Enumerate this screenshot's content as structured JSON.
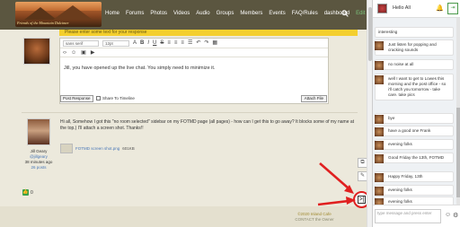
{
  "header": {
    "logo_text": "Friends of the Mountain Dulcimer",
    "nav": [
      "Home",
      "Forums",
      "Photos",
      "Videos",
      "Audio",
      "Groups",
      "Members",
      "Events",
      "FAQ/Rules",
      "dashboard",
      "Edit Look"
    ]
  },
  "yellow_bar": "Please enter some text for your response",
  "editor": {
    "font_select": "sans serif",
    "size_select": "12pt",
    "text": "Jill, you have opened up the live chat. You simply need to minimize it.",
    "post_button": "Post Response",
    "share_label": "Share To Timeline",
    "attach_button": "Attach File"
  },
  "comment": {
    "author": "Jill Geary",
    "handle": "@jillgeary",
    "time": "38 minutes ago",
    "points": "26 posts",
    "text": "Hi all, Somehow I got this \"no room selected\" sidebar on my FOTMD page (all pages) - how can I get this to go away? It blocks some of my name at the top.) I'll attach a screen shot. Thanks!!",
    "attachment_name": "FOTMD screen shot.png",
    "attachment_size": "601KB"
  },
  "likes": "0",
  "footer": {
    "line1": "©2020 Inland Cafe",
    "line2": "CONTACT the Owner"
  },
  "chat": {
    "greeting": "Hello All",
    "input_placeholder": "type message and press enter",
    "messages": [
      "interesting",
      "Just listen for popping and cracking sounds",
      "no noise at all",
      "well I want to get to Lowes this morning and the post office - so i'll catch you tomorrow - take care. take pics",
      "bye",
      "have a good one Frank",
      "evening folks",
      "Good Friday the 13th, FOTMD",
      "Happy Friday, 13th",
      "evening folks",
      "evening folks"
    ]
  },
  "colors": {
    "header_bg": "#5b5640",
    "yellow_bar": "#f4cf2e",
    "annotation_red": "#e02020",
    "chat_bg": "#eef1f4"
  }
}
